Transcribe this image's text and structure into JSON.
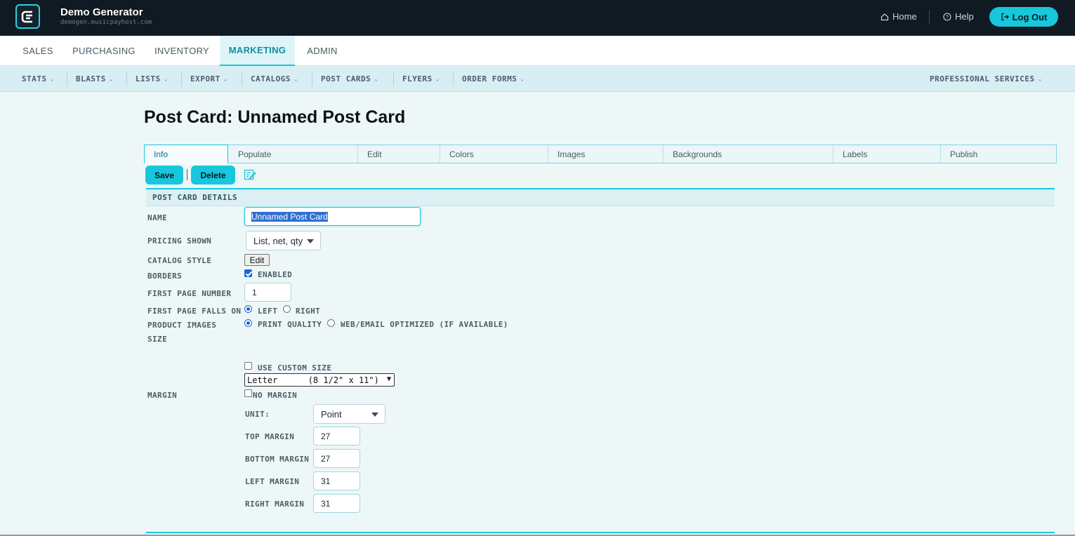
{
  "app": {
    "name": "Demo Generator",
    "host": "demogen.musicpayhost.com"
  },
  "header": {
    "home": "Home",
    "help": "Help",
    "logout": "Log Out"
  },
  "main_nav": [
    "SALES",
    "PURCHASING",
    "INVENTORY",
    "MARKETING",
    "ADMIN"
  ],
  "main_nav_active": "MARKETING",
  "sub_nav": [
    "STATS",
    "BLASTS",
    "LISTS",
    "EXPORT",
    "CATALOGS",
    "POST CARDS",
    "FLYERS",
    "ORDER FORMS"
  ],
  "sub_nav_right": "PROFESSIONAL SERVICES",
  "page": {
    "title": "Post Card: Unnamed Post Card"
  },
  "tabs": [
    "Info",
    "Populate",
    "Edit",
    "Colors",
    "Images",
    "Backgrounds",
    "Labels",
    "Publish"
  ],
  "tabs_active": "Info",
  "toolbar": {
    "save": "Save",
    "delete": "Delete"
  },
  "section": {
    "title": "POST CARD DETAILS"
  },
  "form": {
    "name_label": "NAME",
    "name_value": "Unnamed Post Card",
    "pricing_label": "PRICING SHOWN",
    "pricing_value": "List, net, qty",
    "catalog_style_label": "CATALOG STYLE",
    "catalog_style_button": "Edit",
    "borders_label": "BORDERS",
    "borders_option": "ENABLED",
    "borders_checked": true,
    "first_page_number_label": "FIRST PAGE NUMBER",
    "first_page_number_value": "1",
    "first_page_falls_label": "FIRST PAGE FALLS ON",
    "falls_left": "LEFT",
    "falls_right": "RIGHT",
    "falls_selected": "LEFT",
    "product_images_label": "PRODUCT IMAGES",
    "images_print": "PRINT QUALITY",
    "images_web": "WEB/EMAIL OPTIMIZED (IF AVAILABLE)",
    "images_selected": "PRINT QUALITY",
    "size_label": "SIZE",
    "use_custom_size": "USE CUSTOM SIZE",
    "use_custom_size_checked": false,
    "paper_size": "Letter      (8 1/2\" x 11\")",
    "margin_label": "MARGIN",
    "no_margin": "NO MARGIN",
    "no_margin_checked": false,
    "unit_label": "UNIT:",
    "unit_value": "Point",
    "top_margin_label": "TOP MARGIN",
    "top_margin_value": "27",
    "bottom_margin_label": "BOTTOM MARGIN",
    "bottom_margin_value": "27",
    "left_margin_label": "LEFT MARGIN",
    "left_margin_value": "31",
    "right_margin_label": "RIGHT MARGIN",
    "right_margin_value": "31"
  },
  "colors": {
    "accent": "#17c7dc",
    "header_bg": "#0f1a22",
    "page_bg": "#eef7f8"
  }
}
